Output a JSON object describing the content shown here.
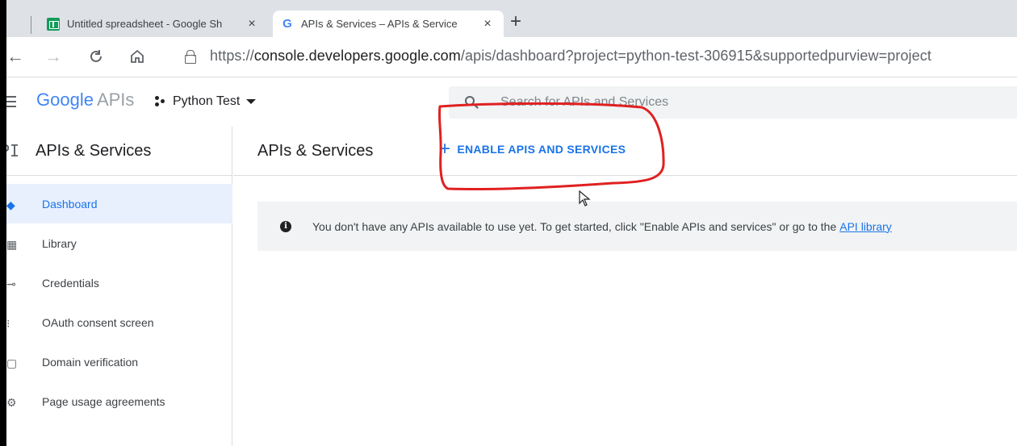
{
  "browser": {
    "tabs": [
      {
        "title": "Untitled spreadsheet - Google Sh",
        "icon": "google-sheets-icon",
        "active": false
      },
      {
        "title": "APIs & Services – APIs & Service",
        "icon": "google-g-icon",
        "active": true
      }
    ],
    "close_glyph": "×",
    "new_tab_glyph": "+",
    "url_scheme": "https://",
    "url_host": "console.developers.google.com",
    "url_path": "/apis/dashboard?project=python-test-306915&supportedpurview=project"
  },
  "header": {
    "logo_word": "Google",
    "logo_product": "APIs",
    "project_name": "Python Test",
    "search_placeholder": "Search for APIs and Services"
  },
  "sidebar": {
    "icon_text": "PI",
    "title": "APIs & Services",
    "items": [
      {
        "label": "Dashboard",
        "active": true
      },
      {
        "label": "Library",
        "active": false
      },
      {
        "label": "Credentials",
        "active": false
      },
      {
        "label": "OAuth consent screen",
        "active": false
      },
      {
        "label": "Domain verification",
        "active": false
      },
      {
        "label": "Page usage agreements",
        "active": false
      }
    ]
  },
  "main": {
    "title": "APIs & Services",
    "enable_plus": "+",
    "enable_label": "ENABLE APIS AND SERVICES",
    "info_icon": "i",
    "info_message": "You don't have any APIs available to use yet. To get started, click \"Enable APIs and services\" or go to the",
    "info_link": "API library"
  },
  "colors": {
    "accent": "#1a73e8",
    "annotation": "#e02020",
    "active_nav_bg": "#e8f0fe"
  }
}
